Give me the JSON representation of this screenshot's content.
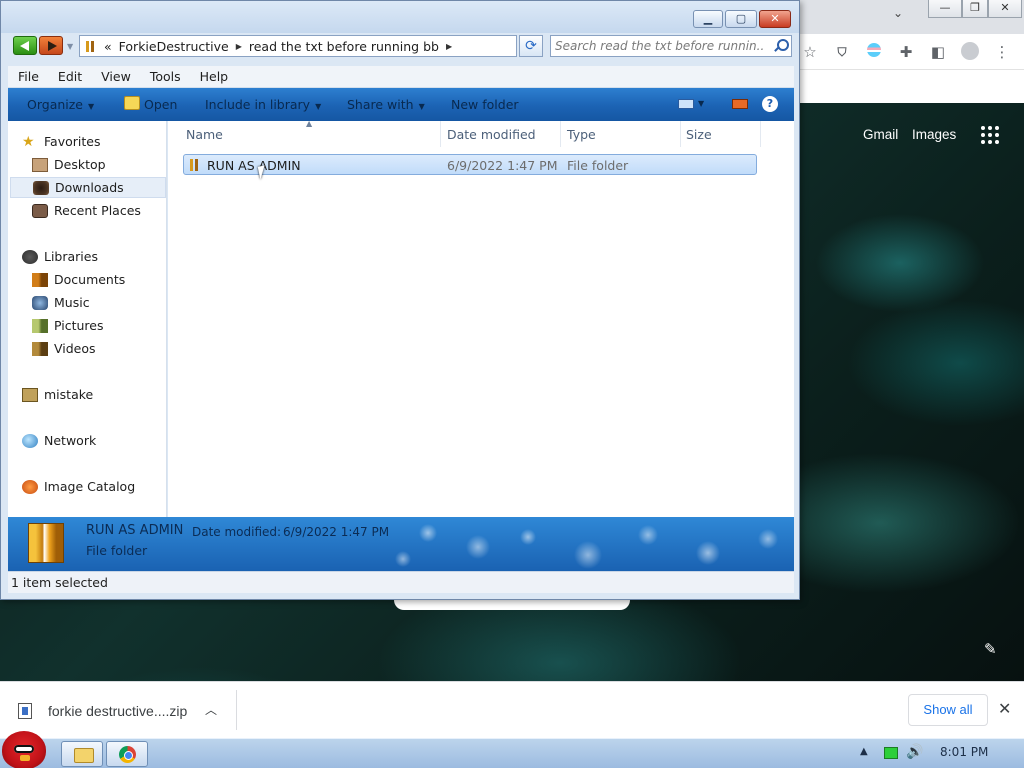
{
  "browser": {
    "links": {
      "gmail": "Gmail",
      "images": "Images"
    },
    "download_bar": {
      "file_name": "forkie destructive....zip",
      "show_all": "Show all"
    }
  },
  "explorer": {
    "title_controls": {
      "minimize": "▭",
      "maximize": "□",
      "close": "✕"
    },
    "breadcrumb": {
      "overflow": "«",
      "parts": [
        "ForkieDestructive",
        "read the txt before running bb"
      ]
    },
    "search": {
      "placeholder": "Search read the txt before runnin..."
    },
    "menu": [
      "File",
      "Edit",
      "View",
      "Tools",
      "Help"
    ],
    "commands": {
      "organize": "Organize",
      "open": "Open",
      "include_in_library": "Include in library",
      "share_with": "Share with",
      "new_folder": "New folder"
    },
    "nav": {
      "favorites": "Favorites",
      "desktop": "Desktop",
      "downloads": "Downloads",
      "recent": "Recent Places",
      "libraries": "Libraries",
      "documents": "Documents",
      "music": "Music",
      "pictures": "Pictures",
      "videos": "Videos",
      "homegroup": "mistake",
      "network": "Network",
      "image_catalog": "Image Catalog"
    },
    "columns": {
      "name": "Name",
      "date": "Date modified",
      "type": "Type",
      "size": "Size"
    },
    "files": [
      {
        "name": "RUN AS ADMIN",
        "date": "6/9/2022 1:47 PM",
        "type": "File folder",
        "size": ""
      }
    ],
    "details": {
      "name": "RUN AS ADMIN",
      "date_label": "Date modified:",
      "date_value": "6/9/2022 1:47 PM",
      "type": "File folder"
    },
    "status": "1 item selected"
  },
  "taskbar": {
    "clock": "8:01 PM"
  }
}
